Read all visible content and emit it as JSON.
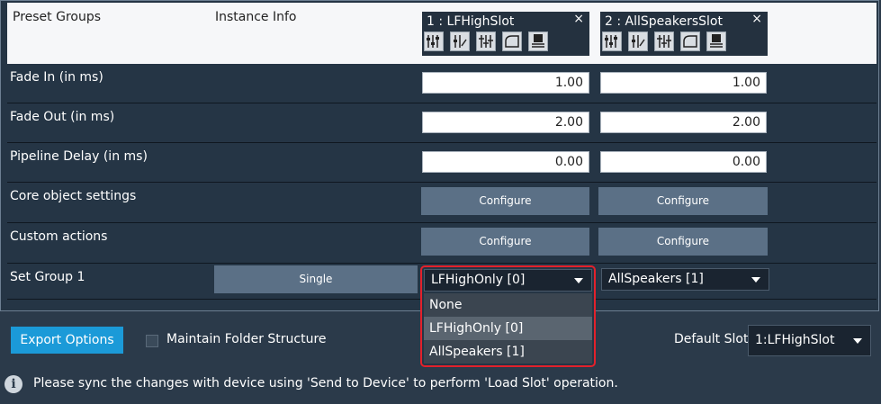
{
  "header": {
    "preset_groups": "Preset Groups",
    "instance_info": "Instance Info"
  },
  "slots": [
    {
      "name": "1 : LFHighSlot",
      "close": "×",
      "icons": [
        "equalizer-icon",
        "level-icon",
        "mixer-icon",
        "curve-icon",
        "save-to-device-icon"
      ]
    },
    {
      "name": "2 : AllSpeakersSlot",
      "close": "×",
      "icons": [
        "equalizer-icon",
        "level-icon",
        "mixer-icon",
        "curve-icon",
        "save-to-device-icon"
      ]
    }
  ],
  "rows": {
    "fade_in": {
      "label": "Fade In (in ms)",
      "values": [
        "1.00",
        "1.00"
      ]
    },
    "fade_out": {
      "label": "Fade Out (in ms)",
      "values": [
        "2.00",
        "2.00"
      ]
    },
    "pipeline_delay": {
      "label": "Pipeline Delay (in ms)",
      "values": [
        "0.00",
        "0.00"
      ]
    },
    "core_object": {
      "label": "Core object settings",
      "button": "Configure"
    },
    "custom_actions": {
      "label": "Custom actions",
      "button": "Configure"
    },
    "set_group": {
      "label": "Set Group 1",
      "mode": "Single",
      "selects": [
        "LFHighOnly [0]",
        "AllSpeakers [1]"
      ]
    }
  },
  "dropdown": {
    "options": [
      "None",
      "LFHighOnly [0]",
      "AllSpeakers [1]"
    ],
    "highlighted": "LFHighOnly [0]",
    "highlight_color": "#e3212b"
  },
  "footer": {
    "export_options": "Export Options",
    "maintain_folder": "Maintain Folder Structure",
    "default_slot_label": "Default Slot",
    "default_slot_value": "1:LFHighSlot",
    "info_message": "Please sync the changes with device using 'Send to Device' to perform 'Load Slot' operation."
  },
  "colors": {
    "accent": "#1b9ad8",
    "background": "#2b3a4a",
    "button": "#5b7086"
  }
}
